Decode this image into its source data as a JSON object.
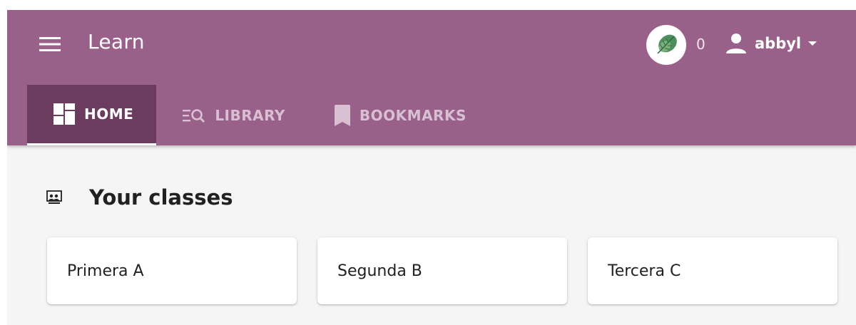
{
  "header": {
    "title": "Learn",
    "menu_icon": "hamburger-menu-icon",
    "points_icon": "leaf-points-icon",
    "points": "0",
    "user_icon": "person-icon",
    "username": "abbyl",
    "dropdown_icon": "caret-down-icon"
  },
  "tabs": [
    {
      "label": "HOME",
      "icon": "dashboard-icon",
      "active": true
    },
    {
      "label": "LIBRARY",
      "icon": "library-search-icon",
      "active": false
    },
    {
      "label": "BOOKMARKS",
      "icon": "bookmark-icon",
      "active": false
    }
  ],
  "classes": {
    "heading": "Your classes",
    "icon": "classroom-icon",
    "items": [
      {
        "name": "Primera A"
      },
      {
        "name": "Segunda B"
      },
      {
        "name": "Tercera C"
      }
    ]
  },
  "colors": {
    "appbar": "#996189",
    "active_tab": "#6b3c5e",
    "inactive_tab_text": "#d8bfd1",
    "page_background": "#f5f5f5"
  }
}
